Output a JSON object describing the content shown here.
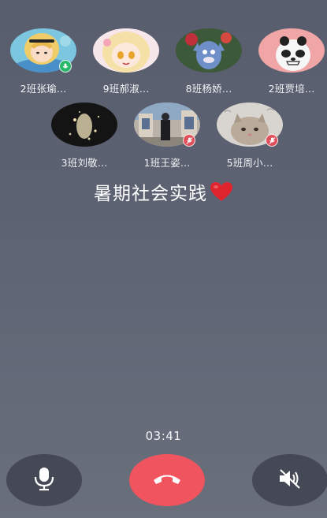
{
  "participants": [
    {
      "name": "2班张瑜...",
      "mic": "on"
    },
    {
      "name": "9班郝淑...",
      "mic": "none"
    },
    {
      "name": "8班杨娇...",
      "mic": "none"
    },
    {
      "name": "2班贾培...",
      "mic": "none"
    },
    {
      "name": "3班刘敬...",
      "mic": "none"
    },
    {
      "name": "1班王姿...",
      "mic": "off"
    },
    {
      "name": "5班周小...",
      "mic": "off"
    }
  ],
  "call": {
    "title": "暑期社会实践",
    "title_emoji": "heart-icon",
    "duration": "03:41"
  },
  "controls": {
    "mic_icon": "microphone-icon",
    "hangup_icon": "phone-hangup-icon",
    "speaker_icon": "speaker-muted-icon"
  },
  "colors": {
    "accent_hangup": "#f0545e",
    "mic_on": "#2ab86b",
    "mic_off": "#e0505a",
    "heart": "#e0242e"
  }
}
